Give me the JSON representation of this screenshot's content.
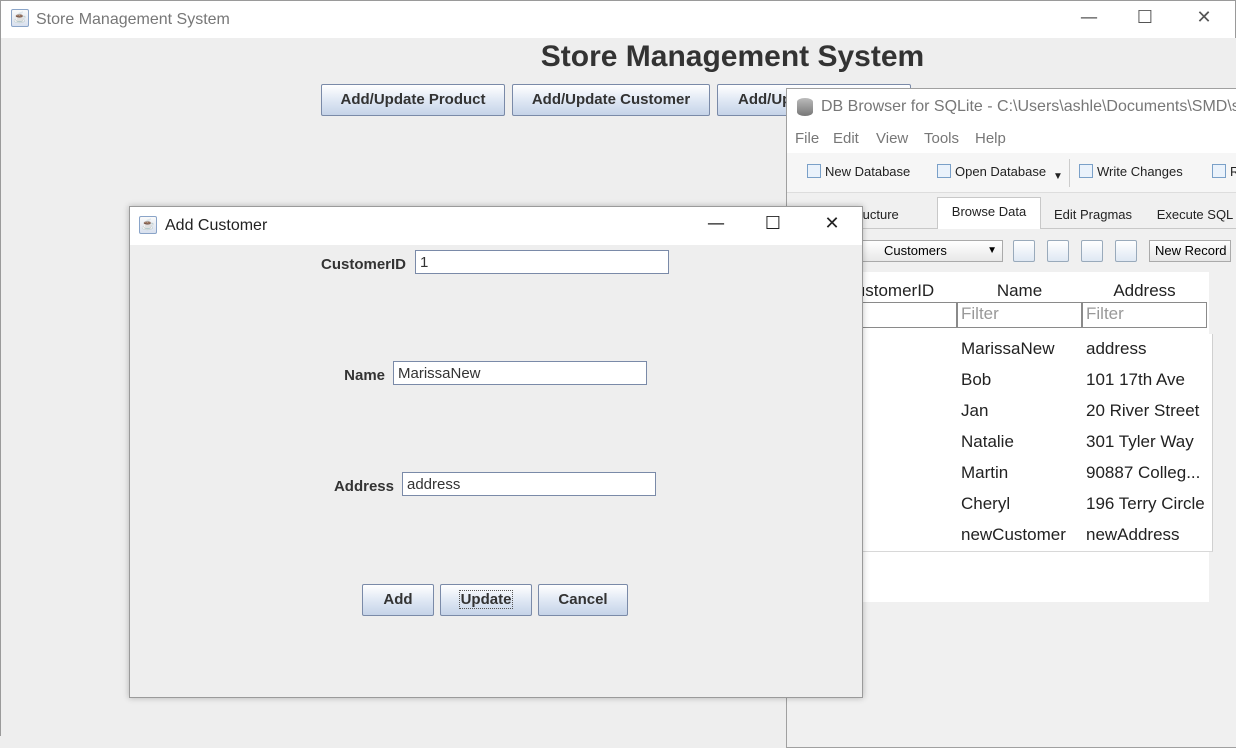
{
  "main_window": {
    "title": "Store Management System",
    "heading": "Store Management System",
    "buttons": [
      "Add/Update Product",
      "Add/Update Customer",
      "Add/Up"
    ],
    "controls": {
      "minimize": "—",
      "maximize": "☐",
      "close": "✕"
    }
  },
  "db_browser": {
    "title": "DB Browser for SQLite - C:\\Users\\ashle\\Documents\\SMD\\store.",
    "menu": [
      "File",
      "Edit",
      "View",
      "Tools",
      "Help"
    ],
    "toolbar": [
      "New Database",
      "Open Database",
      "Write Changes",
      "R"
    ],
    "tabs": [
      "e Structure",
      "Browse Data",
      "Edit Pragmas",
      "Execute SQL"
    ],
    "active_tab": "Browse Data",
    "table_select": "Customers",
    "new_record": "New Record",
    "columns": [
      "ustomerID",
      "Name",
      "Address"
    ],
    "filter_placeholders": [
      "er",
      "Filter",
      "Filter"
    ],
    "rows": [
      {
        "name": "MarissaNew",
        "address": "address"
      },
      {
        "name": "Bob",
        "address": "101 17th Ave"
      },
      {
        "name": "Jan",
        "address": "20 River Street"
      },
      {
        "name": "Natalie",
        "address": "301 Tyler Way"
      },
      {
        "name": "Martin",
        "address": "90887 Colleg..."
      },
      {
        "name": "Cheryl",
        "address": "196 Terry Circle"
      },
      {
        "name": "newCustomer",
        "address": "newAddress"
      }
    ]
  },
  "dialog": {
    "title": "Add Customer",
    "fields": {
      "customer_id": {
        "label": "CustomerID",
        "value": "1"
      },
      "name": {
        "label": "Name",
        "value": "MarissaNew"
      },
      "address": {
        "label": "Address",
        "value": "address"
      }
    },
    "buttons": {
      "add": "Add",
      "update": "Update",
      "cancel": "Cancel"
    }
  }
}
